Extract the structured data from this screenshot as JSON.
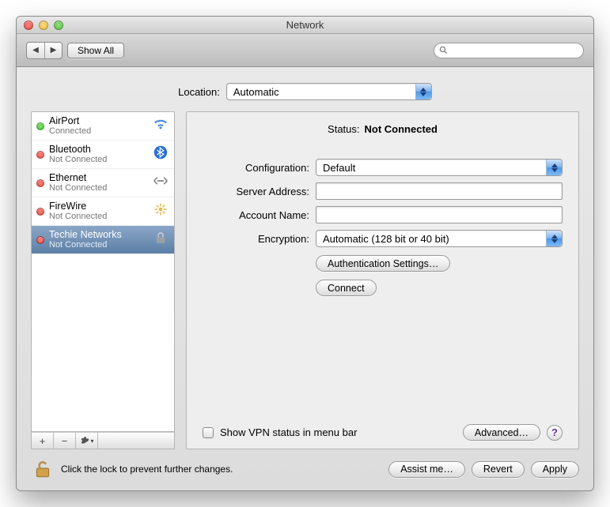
{
  "window": {
    "title": "Network"
  },
  "toolbar": {
    "show_all": "Show All",
    "search_placeholder": ""
  },
  "location": {
    "label": "Location:",
    "value": "Automatic"
  },
  "connections": {
    "items": [
      {
        "name": "AirPort",
        "status": "Connected",
        "status_color": "green",
        "icon": "wifi-icon"
      },
      {
        "name": "Bluetooth",
        "status": "Not Connected",
        "status_color": "red",
        "icon": "bluetooth-icon"
      },
      {
        "name": "Ethernet",
        "status": "Not Connected",
        "status_color": "red",
        "icon": "ethernet-icon"
      },
      {
        "name": "FireWire",
        "status": "Not Connected",
        "status_color": "red",
        "icon": "firewire-icon"
      },
      {
        "name": "Techie Networks",
        "status": "Not Connected",
        "status_color": "red",
        "icon": "vpn-lock-icon",
        "selected": true
      }
    ],
    "toolbar_buttons": {
      "add": "+",
      "remove": "−",
      "gear": "gear-icon"
    }
  },
  "detail": {
    "status_label": "Status:",
    "status_value": "Not Connected",
    "configuration_label": "Configuration:",
    "configuration_value": "Default",
    "server_address_label": "Server Address:",
    "server_address_value": "",
    "account_name_label": "Account Name:",
    "account_name_value": "",
    "encryption_label": "Encryption:",
    "encryption_value": "Automatic (128 bit or 40 bit)",
    "auth_settings": "Authentication Settings…",
    "connect": "Connect",
    "show_vpn_label": "Show VPN status in menu bar",
    "advanced": "Advanced…"
  },
  "lock_text": "Click the lock to prevent further changes.",
  "buttons": {
    "assist_me": "Assist me…",
    "revert": "Revert",
    "apply": "Apply"
  }
}
